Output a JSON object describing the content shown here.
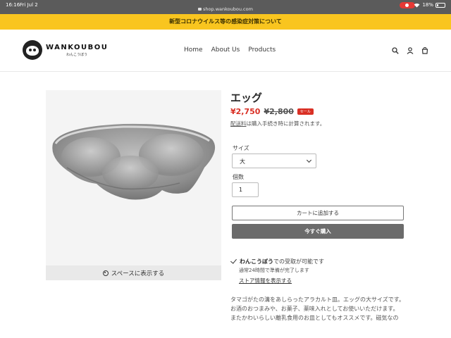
{
  "status_bar": {
    "time": "16:16",
    "date": "Fri Jul 2",
    "url": "shop.wankoubou.com",
    "battery": "18%",
    "battery_level": 0.18
  },
  "announcement": "新型コロナウイルス等の感染症対策について",
  "header": {
    "logo_name": "WANKOUBOU",
    "logo_sub": "わんこうぼう",
    "nav": [
      "Home",
      "About Us",
      "Products"
    ],
    "icons": [
      "search-icon",
      "account-icon",
      "cart-icon"
    ]
  },
  "product": {
    "ar_button": "スペースに表示する",
    "title": "エッグ",
    "sale_price": "¥2,750",
    "original_price": "¥2,800",
    "sale_badge": "セール",
    "shipping_link": "配送料",
    "shipping_rest": "は購入手続き時に計算されます。",
    "size_label": "サイズ",
    "size_value": "大",
    "qty_label": "個数",
    "qty_value": "1",
    "add_to_cart": "カートに追加する",
    "buy_now": "今すぐ購入",
    "pickup_store": "わんこうぼう",
    "pickup_rest": "での受取が可能です",
    "pickup_sub": "通常24時間で準備が完了します",
    "pickup_link": "ストア情報を表示する",
    "description": [
      "タマゴがたの溝をあしらったアラカルト皿。エッグの大サイズです。",
      "お酒のおつまみや、お菓子、薬味入れとしてお使いいただけます。",
      "またかわいらしい離乳食用のお皿としてもオススメです。磁気なの"
    ]
  },
  "colors": {
    "announcement_bg": "#f9c51f",
    "sale": "#d93025",
    "buy_button": "#6b6b6b"
  }
}
